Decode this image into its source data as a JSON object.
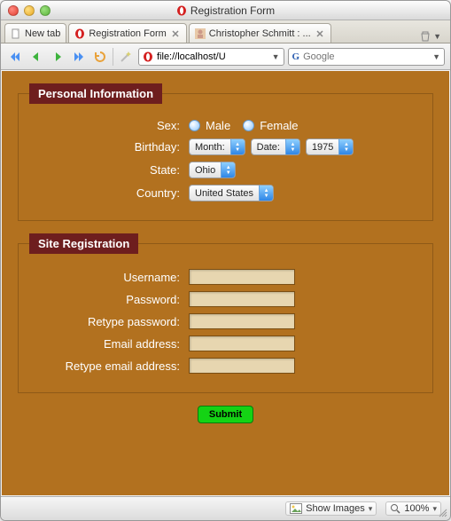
{
  "window": {
    "title": "Registration Form"
  },
  "tabs": [
    {
      "label": "New tab",
      "favicon": "doc"
    },
    {
      "label": "Registration Form",
      "favicon": "opera",
      "active": true
    },
    {
      "label": "Christopher Schmitt : ...",
      "favicon": "avatar"
    }
  ],
  "address": {
    "scheme_icon": "opera",
    "url": "file://localhost/U"
  },
  "search": {
    "provider_icon": "G",
    "placeholder": "Google"
  },
  "form": {
    "section1": {
      "legend": "Personal Information",
      "sex_label": "Sex:",
      "male": "Male",
      "female": "Female",
      "birthday_label": "Birthday:",
      "month": "Month:",
      "date": "Date:",
      "year": "1975",
      "state_label": "State:",
      "state": "Ohio",
      "country_label": "Country:",
      "country": "United States"
    },
    "section2": {
      "legend": "Site Registration",
      "username": "Username:",
      "password": "Password:",
      "retype_password": "Retype password:",
      "email": "Email address:",
      "retype_email": "Retype email address:"
    },
    "submit": "Submit"
  },
  "status": {
    "show_images": "Show Images",
    "zoom": "100%"
  }
}
